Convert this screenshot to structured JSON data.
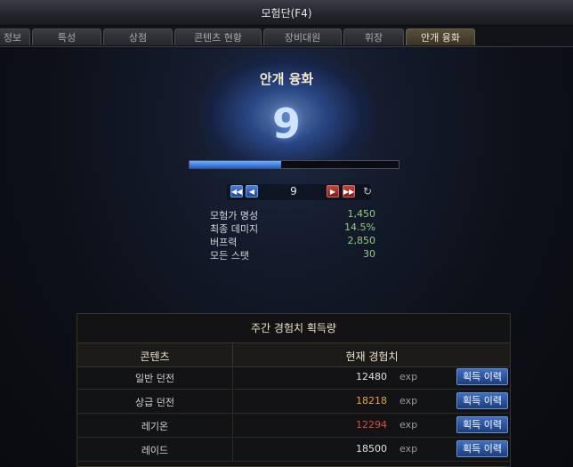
{
  "window": {
    "title": "모험단(F4)"
  },
  "tabs": [
    {
      "label": "정보"
    },
    {
      "label": "특성"
    },
    {
      "label": "상점"
    },
    {
      "label": "콘텐츠 현황"
    },
    {
      "label": "장비대원"
    },
    {
      "label": "휘장"
    },
    {
      "label": "안개 융화",
      "active": true
    }
  ],
  "fusion": {
    "heading": "안개 융화",
    "level": "9",
    "progress_fraction": 0.44,
    "nav_level": "9",
    "icons": {
      "first": "double-left-icon",
      "prev": "left-icon",
      "next": "right-icon",
      "last": "double-right-icon",
      "reset": "refresh-icon"
    }
  },
  "stats": [
    {
      "label": "모험가 명성",
      "value": "1,450"
    },
    {
      "label": "최종 데미지",
      "value": "14.5%"
    },
    {
      "label": "버프력",
      "value": "2,850"
    },
    {
      "label": "모든 스탯",
      "value": "30"
    }
  ],
  "weekly": {
    "title": "주간 경험치 획득량",
    "col_content": "콘텐츠",
    "col_exp": "현재 경험치",
    "rows": [
      {
        "name": "일반 던전",
        "exp": "12480",
        "unit": "exp",
        "button": "획득 이력",
        "color": "#e0e0e0"
      },
      {
        "name": "상급 던전",
        "exp": "18218",
        "unit": "exp",
        "button": "획득 이력",
        "color": "#e8a24a"
      },
      {
        "name": "레기온",
        "exp": "12294",
        "unit": "exp",
        "button": "획득 이력",
        "color": "#e04a3a"
      },
      {
        "name": "레이드",
        "exp": "18500",
        "unit": "exp",
        "button": "획득 이력",
        "color": "#e0e0e0"
      }
    ]
  },
  "colors": {
    "accent": "#f0e4c8",
    "stat_value": "#8fcf7a",
    "button": "#2b5aa8"
  }
}
